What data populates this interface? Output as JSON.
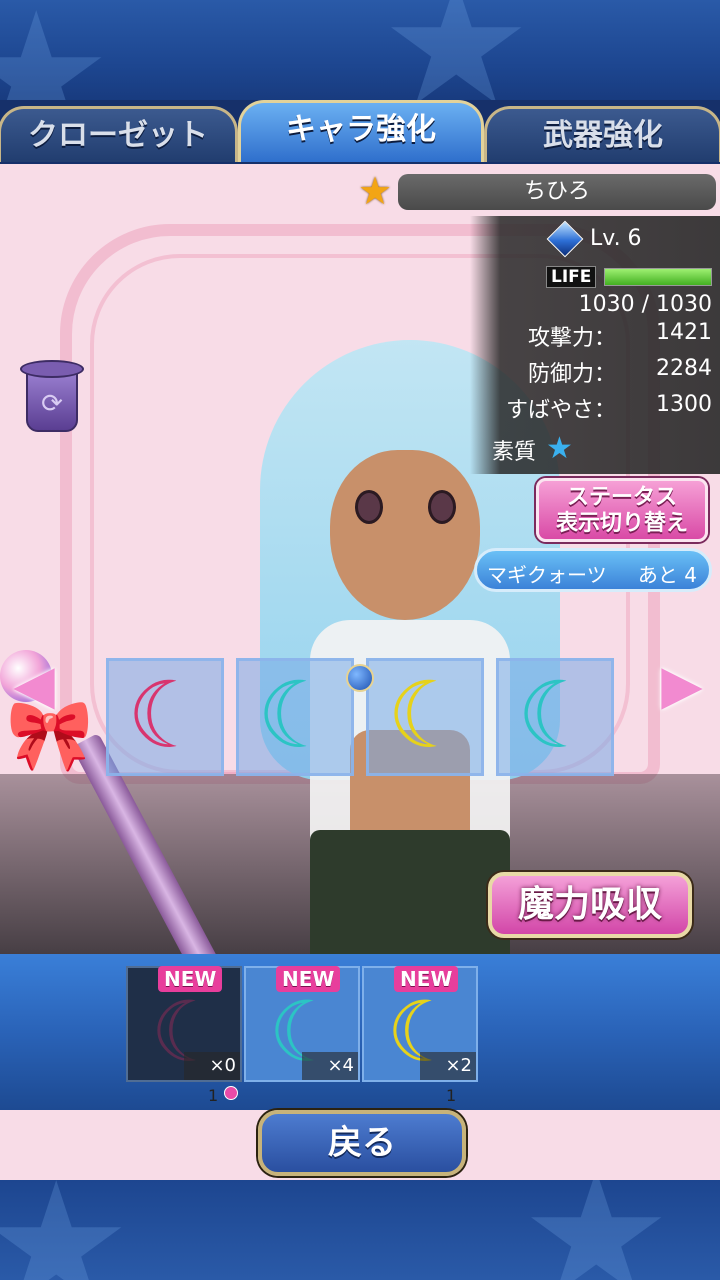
{
  "tabs": [
    {
      "label": "クローゼット",
      "active": false
    },
    {
      "label": "キャラ強化",
      "active": true
    },
    {
      "label": "武器強化",
      "active": false
    }
  ],
  "character": {
    "name": "ちひろ",
    "level": "Lv.  6",
    "life_label": "LIFE",
    "life_fraction": 1.0,
    "life_text": "1030 / 1030",
    "stats": [
      {
        "label": "攻撃力：",
        "value": "1421"
      },
      {
        "label": "防御力：",
        "value": "2284"
      },
      {
        "label": "すばやさ：",
        "value": "1300"
      }
    ],
    "quality_label": "素質",
    "quality_icon": "star-icon"
  },
  "buttons": {
    "status_toggle": "ステータス\n表示切り替え",
    "absorb": "魔力吸収",
    "back": "戻る"
  },
  "quartz": {
    "label": "マギクォーツ",
    "remaining": "あと 4"
  },
  "slots": [
    {
      "icon": "moon-icon",
      "color": "#d8356f"
    },
    {
      "icon": "moon-icon",
      "color": "#2cc4c4"
    },
    {
      "icon": "moon-icon",
      "color": "#e6d21a"
    },
    {
      "icon": "moon-icon",
      "color": "#2cc4c4"
    }
  ],
  "inventory": {
    "items": [
      {
        "badge": "NEW",
        "count": "×0",
        "color": "#8a2a55",
        "dim": true
      },
      {
        "badge": "NEW",
        "count": "×4",
        "color": "#2cc4c4",
        "dim": false
      },
      {
        "badge": "NEW",
        "count": "×2",
        "color": "#e6d21a",
        "dim": false
      }
    ],
    "page_left": "1",
    "page_right": "1"
  },
  "colors": {
    "accent_pink": "#d94aa6",
    "accent_blue": "#2f6fcc",
    "gold_border": "#c8b688"
  }
}
